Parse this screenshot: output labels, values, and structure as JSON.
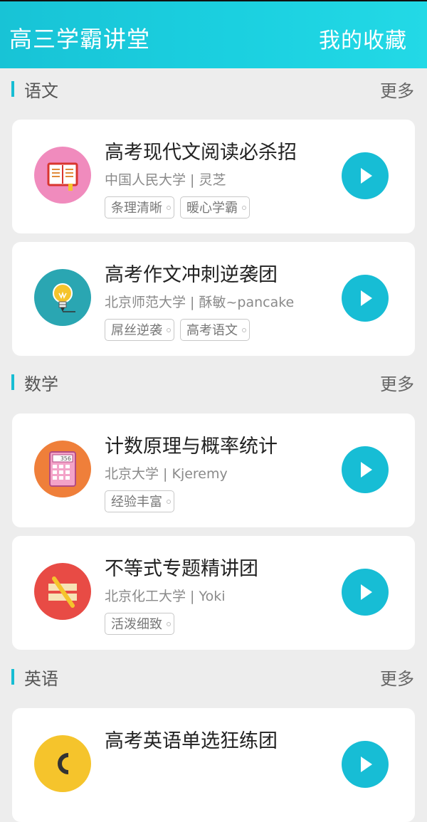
{
  "header": {
    "title": "高三学霸讲堂",
    "favorites_label": "我的收藏"
  },
  "sections": [
    {
      "name": "语文",
      "more_label": "更多",
      "courses": [
        {
          "title": "高考现代文阅读必杀招",
          "author": "中国人民大学 | 灵芝",
          "tags": [
            "条理清晰",
            "暖心学霸"
          ],
          "icon": "book-icon",
          "icon_color": "#f08bbd"
        },
        {
          "title": "高考作文冲刺逆袭团",
          "author": "北京师范大学 | 酥敏~pancake",
          "tags": [
            "屌丝逆袭",
            "高考语文"
          ],
          "icon": "lightbulb-icon",
          "icon_color": "#2aa6b2"
        }
      ]
    },
    {
      "name": "数学",
      "more_label": "更多",
      "courses": [
        {
          "title": "计数原理与概率统计",
          "author": "北京大学 | Kjeremy",
          "tags": [
            "经验丰富"
          ],
          "icon": "calculator-icon",
          "icon_color": "#ef7f3a",
          "icon_text": "356"
        },
        {
          "title": "不等式专题精讲团",
          "author": "北京化工大学 | Yoki",
          "tags": [
            "活泼细致"
          ],
          "icon": "ruler-icon",
          "icon_color": "#e84b45"
        }
      ]
    },
    {
      "name": "英语",
      "more_label": "更多",
      "courses": [
        {
          "title": "高考英语单选狂练团",
          "author": "",
          "tags": [],
          "icon": "english-icon",
          "icon_color": "#f5c42c"
        }
      ]
    }
  ],
  "colors": {
    "accent": "#17bdd5",
    "background": "#ededed"
  }
}
